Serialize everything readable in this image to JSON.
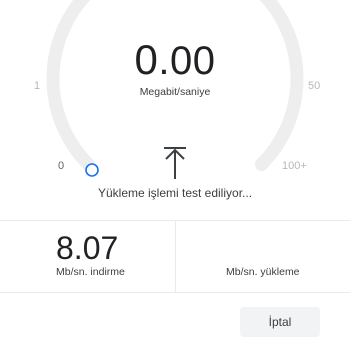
{
  "gauge": {
    "speed_int": "0",
    "speed_frac": ".00",
    "unit": "Megabit/saniye",
    "tick_0": "0",
    "tick_1": "1",
    "tick_50": "50",
    "tick_100": "100+",
    "progress_fraction": 0,
    "track_color": "#eeeeee",
    "handle_color": "#1a73e8"
  },
  "status": "Yükleme işlemi test ediliyor...",
  "results": {
    "download_value": "8.07",
    "download_label": "Mb/sn. indirme",
    "upload_value": "",
    "upload_label": "Mb/sn. yükleme"
  },
  "actions": {
    "cancel_label": "İptal"
  }
}
